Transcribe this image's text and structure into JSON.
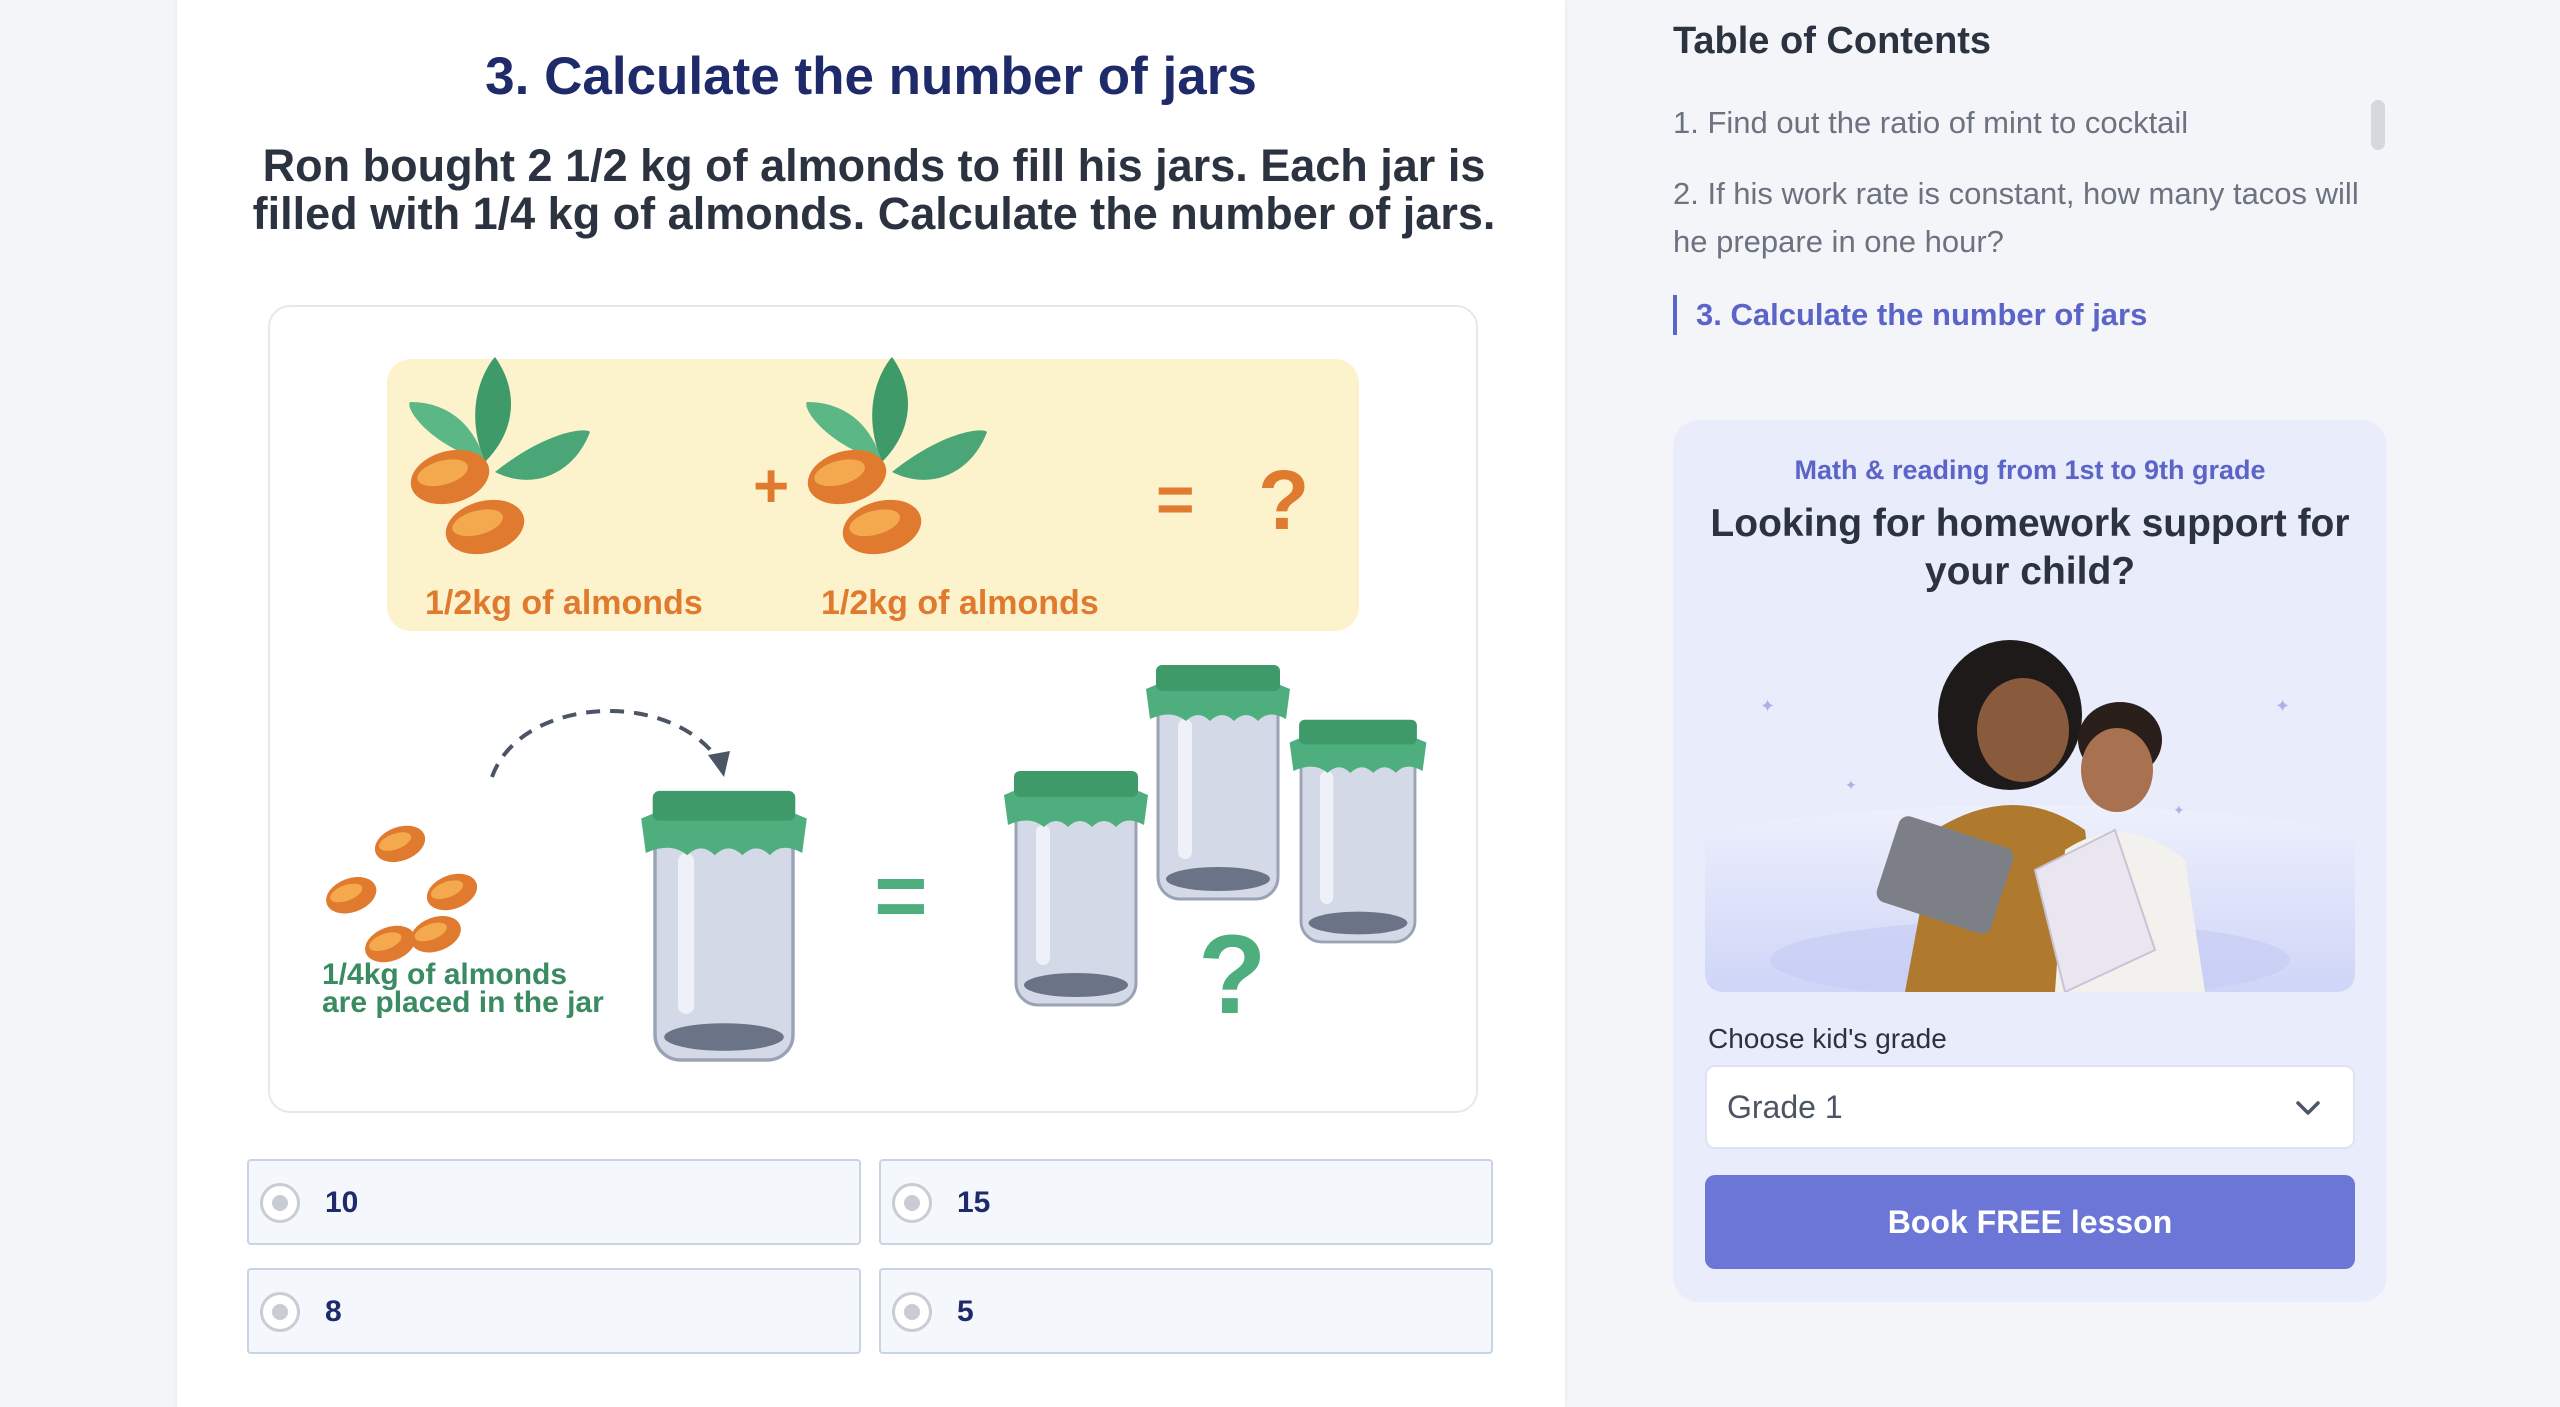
{
  "question": {
    "title": "3. Calculate the number of jars",
    "text": "Ron bought 2 1/2 kg of almonds to fill his jars. Each jar is filled with 1/4  kg of almonds. Calculate the number of jars."
  },
  "illustration": {
    "label_left": "1/2kg of almonds",
    "label_right": "1/2kg of almonds",
    "plus": "+",
    "equals": "=",
    "question_mark": "?",
    "jar_caption_line1": "1/4kg  of  almonds",
    "jar_caption_line2": "are placed in the jar"
  },
  "options": [
    {
      "label": "10"
    },
    {
      "label": "15"
    },
    {
      "label": "8"
    },
    {
      "label": "5"
    }
  ],
  "toc": {
    "title": "Table of Contents",
    "items": [
      {
        "label": "1. Find out the ratio of mint to cocktail"
      },
      {
        "label": "2. If his work rate is constant, how many tacos will he prepare in one hour?"
      },
      {
        "label": "3. Calculate the number of jars"
      }
    ]
  },
  "promo": {
    "subtitle": "Math & reading from 1st to 9th grade",
    "headline": "Looking for homework support for your child?",
    "grade_label": "Choose kid's grade",
    "grade_value": "Grade 1",
    "button": "Book FREE lesson"
  },
  "colors": {
    "title": "#1f2a6b",
    "accent": "#5b64c8",
    "button": "#6b76d6",
    "almond": "#e07a2e",
    "leaf": "#3f9a6a",
    "jar_lid": "#4fae7e"
  }
}
